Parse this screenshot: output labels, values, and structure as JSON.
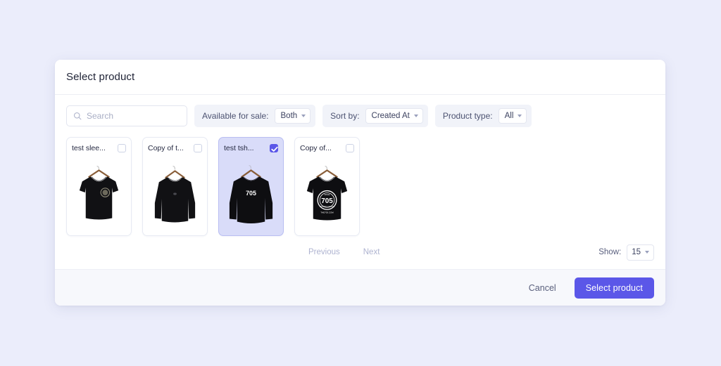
{
  "page": {
    "background_color": "#ebedfb",
    "accent_color": "#5b57e8"
  },
  "modal": {
    "title": "Select product"
  },
  "search": {
    "placeholder": "Search",
    "value": "",
    "icon": "search-icon"
  },
  "filters": [
    {
      "label": "Available for sale:",
      "value": "Both",
      "icon": "chevron-down-icon"
    },
    {
      "label": "Sort by:",
      "value": "Created At",
      "icon": "chevron-down-icon"
    },
    {
      "label": "Product type:",
      "value": "All",
      "icon": "chevron-down-icon"
    }
  ],
  "products": [
    {
      "title": "test slee...",
      "selected": false,
      "image": "black-tshirt-small-circle-logo"
    },
    {
      "title": "Copy of t...",
      "selected": false,
      "image": "black-longsleeve-plain"
    },
    {
      "title": "test tsh...",
      "selected": true,
      "image": "black-longsleeve-705"
    },
    {
      "title": "Copy of...",
      "selected": false,
      "image": "black-tshirt-705-circle-logo"
    }
  ],
  "pagination": {
    "previous_label": "Previous",
    "next_label": "Next",
    "show_label": "Show:",
    "show_value": "15",
    "show_icon": "chevron-down-icon"
  },
  "footer": {
    "cancel_label": "Cancel",
    "submit_label": "Select product"
  },
  "shirt_graphic": {
    "logo_text": "705",
    "logo_top_text": "SINCE",
    "logo_bottom_text": "ONTARIO CANADA",
    "logo_sub_text": "THE705.COM"
  }
}
